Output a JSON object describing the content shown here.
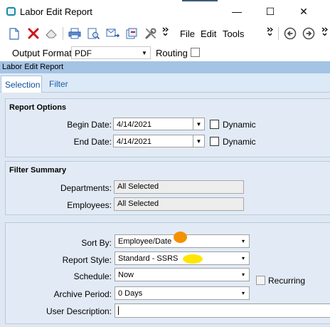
{
  "window": {
    "title": "Labor Edit Report",
    "minimize_symbol": "—",
    "maximize_symbol": "☐",
    "close_symbol": "✕"
  },
  "toolbar": {
    "menus": {
      "file": "File",
      "edit": "Edit",
      "tools": "Tools"
    },
    "icons": [
      "new-document-icon",
      "delete-icon",
      "eraser-icon",
      "print-icon",
      "print-preview-icon",
      "email-icon",
      "refresh-icon",
      "settings-icon",
      "back-icon",
      "forward-icon"
    ],
    "more_symbol": "»"
  },
  "options_bar": {
    "output_format_label": "Output Format:",
    "output_format_value": "PDF",
    "routing_label": "Routing",
    "routing_checked": false
  },
  "header": {
    "title": "Labor Edit Report"
  },
  "tabs": [
    {
      "label": "Selection",
      "active": true
    },
    {
      "label": "Filter",
      "active": false
    }
  ],
  "report_options": {
    "title": "Report Options",
    "begin_date_label": "Begin Date:",
    "begin_date_value": "4/14/2021",
    "end_date_label": "End Date:",
    "end_date_value": "4/14/2021",
    "dynamic_label": "Dynamic"
  },
  "filter_summary": {
    "title": "Filter Summary",
    "departments_label": "Departments:",
    "departments_value": "All Selected",
    "employees_label": "Employees:",
    "employees_value": "All Selected"
  },
  "report_settings": {
    "sort_by_label": "Sort By:",
    "sort_by_value": "Employee/Date",
    "report_style_label": "Report Style:",
    "report_style_value": "Standard - SSRS",
    "schedule_label": "Schedule:",
    "schedule_value": "Now",
    "recurring_label": "Recurring",
    "archive_period_label": "Archive Period:",
    "archive_period_value": "0 Days",
    "user_description_label": "User Description:",
    "user_description_value": ""
  },
  "colors": {
    "header_bar": "#a4c3e5",
    "tab_active_text": "#0b4f9c",
    "orange_marker": "#f39200",
    "yellow_marker": "#ffe600"
  }
}
